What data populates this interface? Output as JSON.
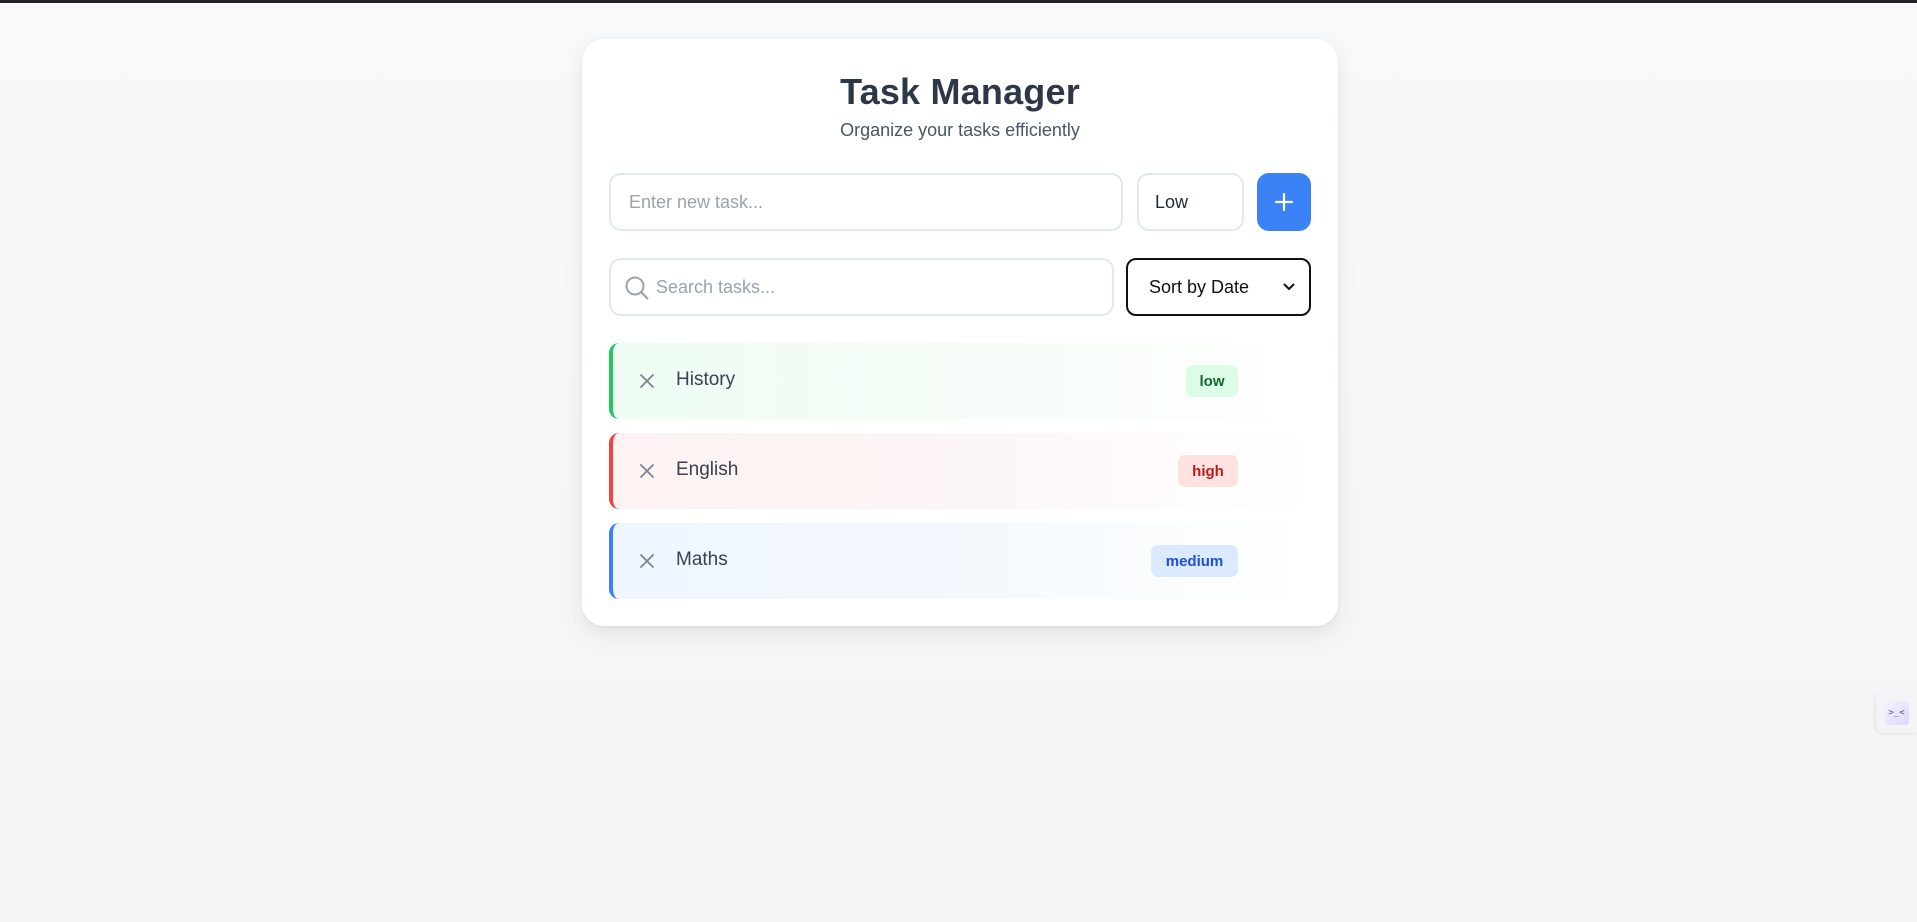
{
  "header": {
    "title": "Task Manager",
    "subtitle": "Organize your tasks efficiently"
  },
  "add_form": {
    "task_placeholder": "Enter new task...",
    "priority_value": "Low",
    "add_icon": "plus-icon"
  },
  "filters": {
    "search_placeholder": "Search tasks...",
    "search_icon": "search-icon",
    "sort_value": "Sort by Date",
    "sort_icon": "chevron-down-icon"
  },
  "tasks": [
    {
      "name": "History",
      "priority": "low",
      "color": "#22c55e"
    },
    {
      "name": "English",
      "priority": "high",
      "color": "#ef4444"
    },
    {
      "name": "Maths",
      "priority": "medium",
      "color": "#3b82f6"
    }
  ],
  "colors": {
    "accent": "#3b82f6",
    "low": "#22c55e",
    "high": "#ef4444",
    "medium": "#3b82f6"
  },
  "side_widget": {
    "glyph": ">_<"
  }
}
